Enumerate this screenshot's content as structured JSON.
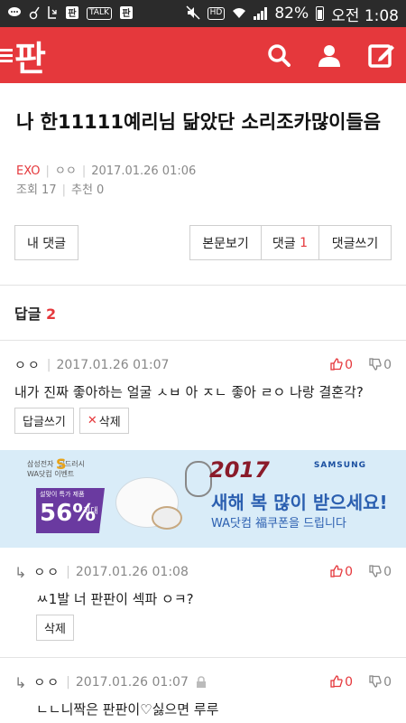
{
  "status_bar": {
    "battery": "82%",
    "time": "오전 1:08",
    "icons": [
      "chat-icon",
      "key-icon",
      "download-icon",
      "pan-app-icon",
      "talk-icon",
      "pan-app-icon",
      "mute-icon",
      "hd-icon",
      "wifi-icon",
      "signal-icon",
      "battery-icon"
    ],
    "chips": {
      "talk": "TALK",
      "hd": "HD"
    }
  },
  "app_bar": {
    "logo": "판",
    "color": "#e5383c",
    "icons": [
      "search-icon",
      "profile-icon",
      "write-icon"
    ]
  },
  "post": {
    "title": "나 한11111예리님 닮았단 소리조카많이들음",
    "category": "EXO",
    "author": "ㅇㅇ",
    "date": "2017.01.26 01:06",
    "views": "조회 17",
    "recommend": "추천 0"
  },
  "buttons": {
    "my_comments": "내 댓글",
    "view_post": "본문보기",
    "comments": "댓글",
    "comments_count": "1",
    "write_comment": "댓글쓰기"
  },
  "replies_section": {
    "label": "답글",
    "count": "2"
  },
  "comment": {
    "author": "ㅇㅇ",
    "date": "2017.01.26 01:07",
    "up": "0",
    "down": "0",
    "body": "내가 진짜 좋아하는 얼굴 ㅅㅂ 아 ㅈㄴ 좋아 ㄹㅇ 나랑 결혼각?",
    "reply_btn": "답글쓰기",
    "delete_btn": "삭제"
  },
  "ad": {
    "small_text": "삼성전자  골드러시\nWA닷컴 이벤트",
    "s_mark": "S",
    "badge_top": "설맞이 특가 제품",
    "badge_pct": "56%",
    "badge_max": "최대",
    "year": "2017",
    "brand": "SAMSUNG",
    "headline": "새해 복 많이 받으세요!",
    "sub": "WA닷컴 福쿠폰을 드립니다"
  },
  "replies": [
    {
      "author": "ㅇㅇ",
      "date": "2017.01.26 01:08",
      "up": "0",
      "down": "0",
      "body": "ㅆ1발 너 판판이 섹파 ㅇㅋ?",
      "delete_btn": "삭제"
    },
    {
      "author": "ㅇㅇ",
      "date": "2017.01.26 01:07",
      "up": "0",
      "down": "0",
      "body": "ㄴㄴ니짝은 판판이♡싫으면 루루"
    }
  ]
}
